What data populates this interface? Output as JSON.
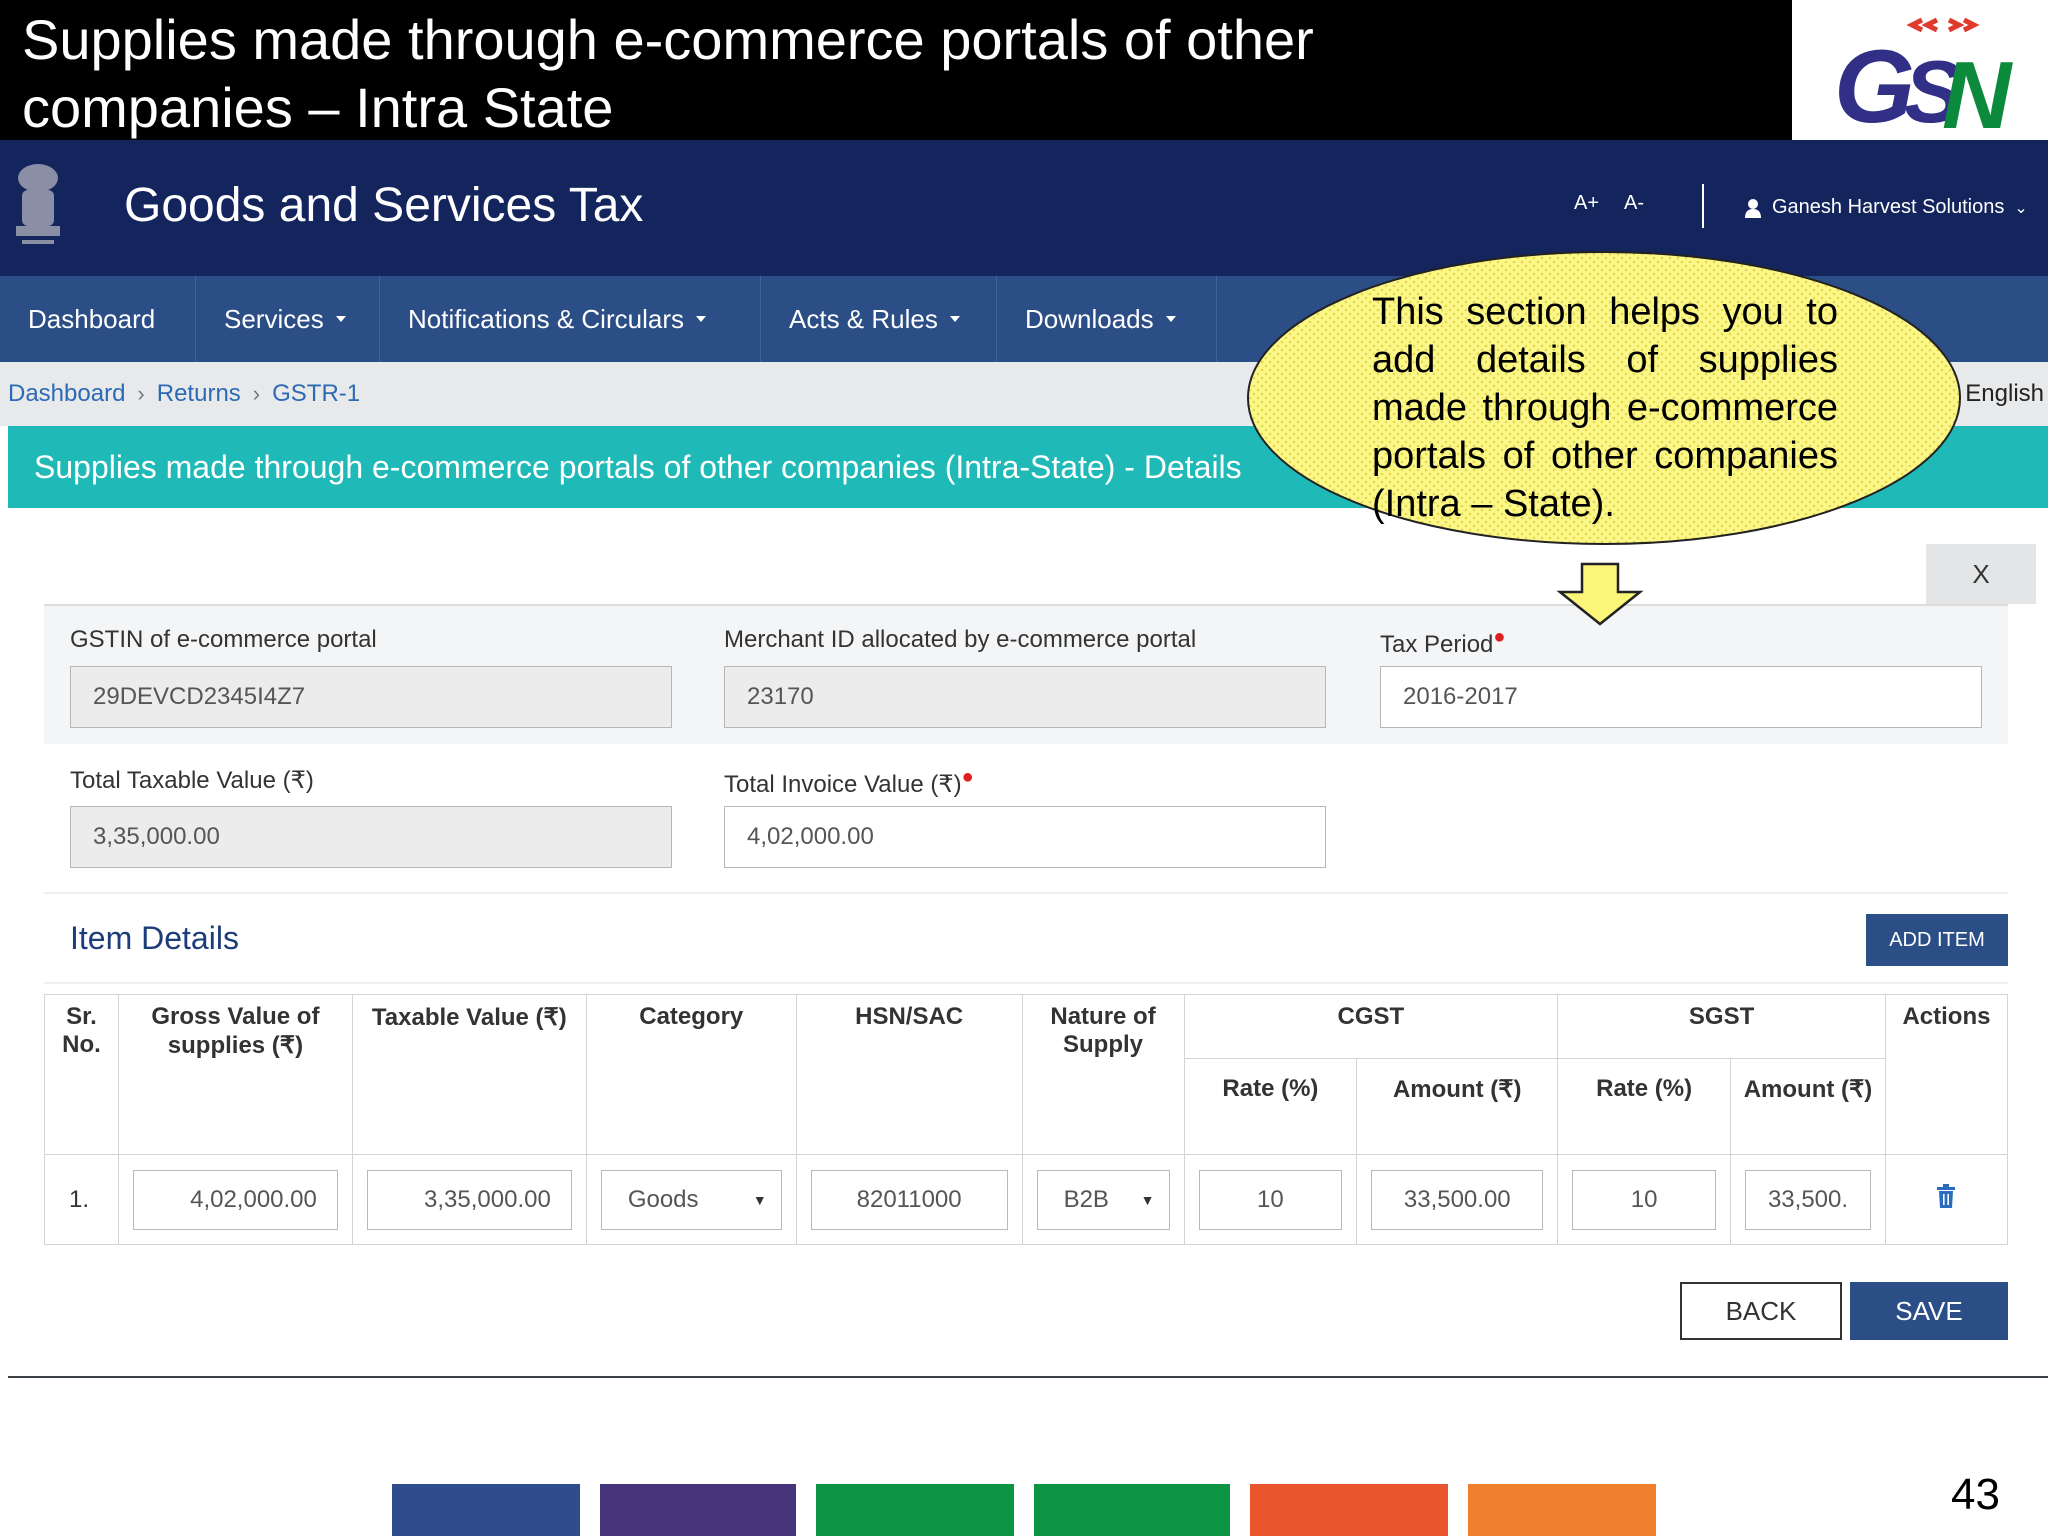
{
  "slide": {
    "title_line1": "Supplies made through e-commerce portals of other",
    "title_line2": "companies – Intra State",
    "logo_text": "GSN",
    "page_number": "43"
  },
  "header": {
    "title": "Goods and Services Tax",
    "font_increase": "A+",
    "font_decrease": "A-",
    "user_name": "Ganesh Harvest Solutions"
  },
  "nav": {
    "items": [
      {
        "label": "Dashboard",
        "dropdown": false
      },
      {
        "label": "Services",
        "dropdown": true
      },
      {
        "label": "Notifications & Circulars",
        "dropdown": true
      },
      {
        "label": "Acts & Rules",
        "dropdown": true
      },
      {
        "label": "Downloads",
        "dropdown": true
      }
    ]
  },
  "breadcrumb": {
    "items": [
      "Dashboard",
      "Returns",
      "GSTR-1"
    ],
    "language": "English"
  },
  "section": {
    "title": "Supplies made through e-commerce portals of other companies (Intra-State) - Details",
    "close_label": "X"
  },
  "form": {
    "gstin_label": "GSTIN of e-commerce portal",
    "gstin_value": "29DEVCD2345I4Z7",
    "merchant_label": "Merchant ID allocated by e-commerce portal",
    "merchant_value": "23170",
    "tax_period_label": "Tax Period",
    "tax_period_value": "2016-2017",
    "taxable_label": "Total Taxable Value (₹)",
    "taxable_value": "3,35,000.00",
    "invoice_label": "Total Invoice Value (₹)",
    "invoice_value": "4,02,000.00"
  },
  "items": {
    "title": "Item Details",
    "add_label": "ADD ITEM",
    "headers": {
      "sr": "Sr. No.",
      "gross": "Gross Value of supplies (₹)",
      "taxable": "Taxable Value (₹)",
      "category": "Category",
      "hsn": "HSN/SAC",
      "nature": "Nature of Supply",
      "cgst": "CGST",
      "sgst": "SGST",
      "actions": "Actions",
      "rate": "Rate (%)",
      "amount": "Amount (₹)"
    },
    "rows": [
      {
        "sr": "1.",
        "gross": "4,02,000.00",
        "taxable": "3,35,000.00",
        "category": "Goods",
        "hsn": "82011000",
        "nature": "B2B",
        "cgst_rate": "10",
        "cgst_amount": "33,500.00",
        "sgst_rate": "10",
        "sgst_amount": "33,500."
      }
    ]
  },
  "actions": {
    "back_label": "BACK",
    "save_label": "SAVE"
  },
  "callout": {
    "text": "This section helps you to add details of supplies made through e-commerce portals of other companies (Intra – State)."
  },
  "colors": {
    "header_bg": "#14245d",
    "nav_bg": "#2c4e86",
    "section_bg": "#1fbab7",
    "callout_fill": "#fbf889",
    "footer": [
      "#2f4c8c",
      "#47357c",
      "#0c9444",
      "#0c9444",
      "#e9552d",
      "#f07f2e"
    ]
  }
}
